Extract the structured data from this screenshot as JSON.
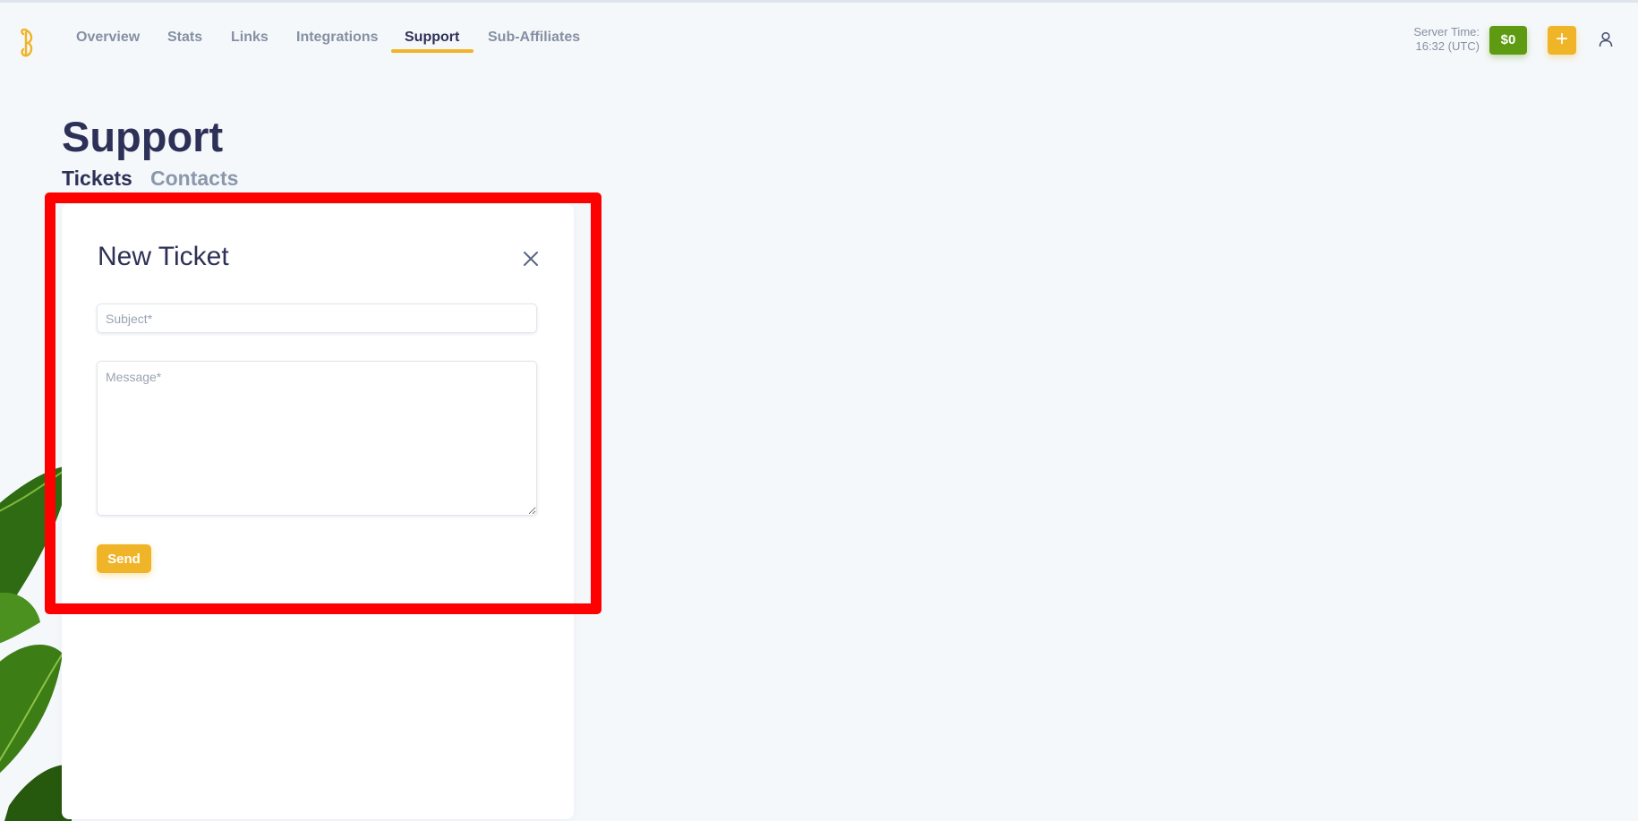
{
  "nav": {
    "items": [
      {
        "label": "Overview"
      },
      {
        "label": "Stats"
      },
      {
        "label": "Links"
      },
      {
        "label": "Integrations"
      },
      {
        "label": "Support",
        "active": true
      },
      {
        "label": "Sub-Affiliates"
      }
    ]
  },
  "header": {
    "server_time_label": "Server Time:",
    "server_time_value": "16:32 (UTC)",
    "balance": "$0",
    "add_label": "+"
  },
  "page": {
    "title": "Support",
    "tabs": [
      {
        "label": "Tickets",
        "active": true
      },
      {
        "label": "Contacts",
        "active": false
      }
    ]
  },
  "modal": {
    "title": "New Ticket",
    "subject_placeholder": "Subject*",
    "subject_value": "",
    "message_placeholder": "Message*",
    "message_value": "",
    "send_label": "Send"
  },
  "colors": {
    "accent": "#f0b429",
    "balance_green": "#5e9a12",
    "text_dark": "#2e3157",
    "highlight_red": "#ff0000"
  },
  "icons": [
    "brand-logo-icon",
    "plus-icon",
    "user-icon",
    "close-icon"
  ]
}
